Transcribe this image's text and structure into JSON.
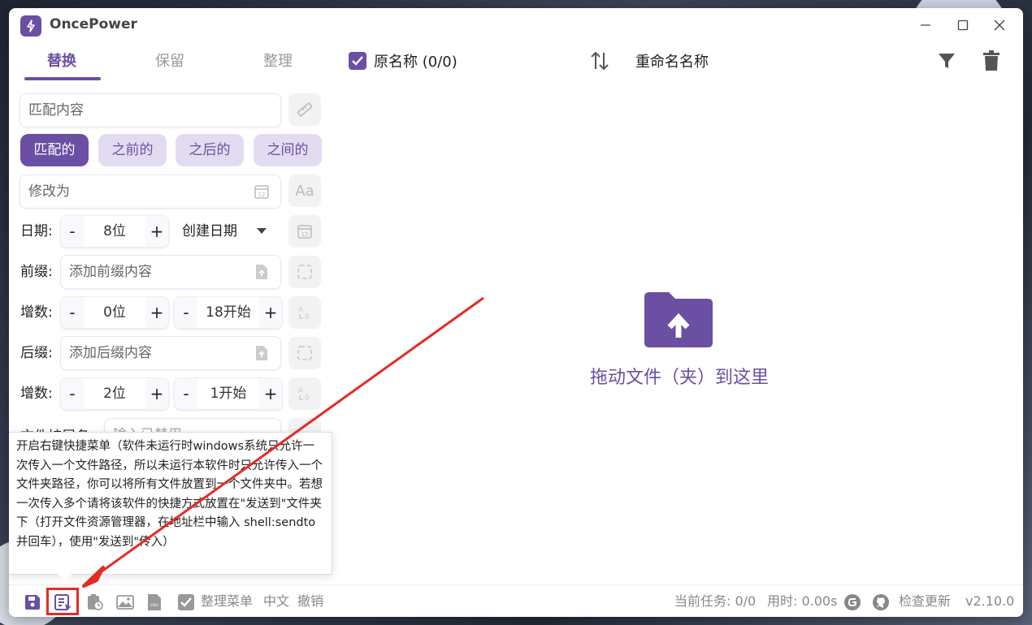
{
  "app": {
    "title": "OncePower"
  },
  "tabs": [
    {
      "label": "替换",
      "active": true
    },
    {
      "label": "保留",
      "active": false
    },
    {
      "label": "整理",
      "active": false
    }
  ],
  "replace": {
    "match_placeholder": "匹配内容",
    "modes": [
      "匹配的",
      "之前的",
      "之后的",
      "之间的"
    ],
    "active_mode": "匹配的",
    "modify_placeholder": "修改为"
  },
  "date_row": {
    "label": "日期:",
    "digits": "8位",
    "type": "创建日期"
  },
  "prefix_row": {
    "label": "前缀:",
    "placeholder": "添加前缀内容"
  },
  "prefix_counter": {
    "label": "增数:",
    "digits": "0位",
    "start": "18开始"
  },
  "suffix_row": {
    "label": "后缀:",
    "placeholder": "添加后缀内容"
  },
  "suffix_counter": {
    "label": "增数:",
    "digits": "2位",
    "start": "1开始"
  },
  "ext_row": {
    "label": "文件扩展名",
    "placeholder": "输入已禁用"
  },
  "tooltip": {
    "text": "开启右键快捷菜单（软件未运行时windows系统只允许一次传入一个文件路径，所以未运行本软件时只允许传入一个文件夹路径，你可以将所有文件放置到一个文件夹中。若想一次传入多个请将该软件的快捷方式放置在\"发送到\"文件夹下（打开文件资源管理器，在地址栏中输入 shell:sendto 并回车），使用\"发送到\"传入）"
  },
  "list_header": {
    "original_name": "原名称 (0/0)",
    "rename_name": "重命名名称",
    "original_checked": true
  },
  "dropzone": {
    "text": "拖动文件（夹）到这里"
  },
  "bottombar": {
    "organize_menu": "整理菜单",
    "language": "中文",
    "undo": "撤销",
    "current_task": "当前任务: 0/0",
    "elapsed": "用时: 0.00s",
    "check_update": "检查更新",
    "version": "v2.10.0"
  },
  "icons": {
    "save": "save-icon",
    "context_menu": "context-menu-icon",
    "clipboard": "clipboard-clock-icon",
    "image": "image-icon",
    "csv": "csv-icon",
    "github": "github-icon"
  },
  "colors": {
    "accent": "#6a4fa3",
    "highlight": "#e52a26"
  }
}
